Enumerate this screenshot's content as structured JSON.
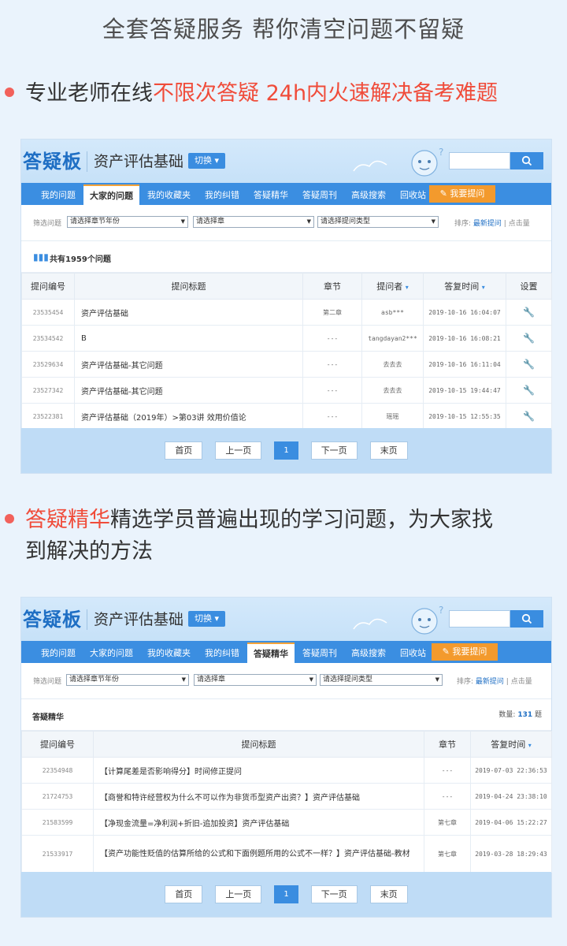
{
  "headline": "全套答疑服务 帮你清空问题不留疑",
  "bullet1": {
    "prefix": "专业老师在线",
    "highlight": "不限次答疑 24h内火速解决备考难题"
  },
  "bullet2": {
    "highlight": "答疑精华",
    "line1": "精选学员普遍出现的学习问题，为大家找",
    "line2": "到解决的方法"
  },
  "panel1": {
    "logo": "答疑板",
    "subject": "资产评估基础",
    "switch_label": "切换",
    "search_placeholder": "",
    "nav": [
      "我的问题",
      "大家的问题",
      "我的收藏夹",
      "我的纠错",
      "答疑精华",
      "答疑周刊",
      "高级搜索",
      "回收站"
    ],
    "active_tab": "大家的问题",
    "ask_label": "我要提问",
    "filter": {
      "label": "筛选问题",
      "sel1": "请选择章节年份",
      "sel2": "请选择章",
      "sel3": "请选择提问类型",
      "sort_label": "排序:",
      "sort_active": "最新提问",
      "sort_other": "点击量"
    },
    "count_text": "共有1959个问题",
    "columns": [
      "提问编号",
      "提问标题",
      "章节",
      "提问者",
      "答复时间",
      "设置"
    ],
    "rows": [
      [
        "23535454",
        "资产评估基础",
        "第二章",
        "asb***",
        "2019-10-16 16:04:07"
      ],
      [
        "23534542",
        "B",
        "---",
        "tangdayan2***",
        "2019-10-16 16:08:21"
      ],
      [
        "23529634",
        "资产评估基础-其它问题",
        "---",
        "去去去",
        "2019-10-16 16:11:04"
      ],
      [
        "23527342",
        "资产评估基础-其它问题",
        "---",
        "去去去",
        "2019-10-15 19:44:47"
      ],
      [
        "23522381",
        "资产评估基础（2019年）>第03讲  效用价值论",
        "---",
        "瑶瑶",
        "2019-10-15 12:55:35"
      ]
    ],
    "pager": {
      "first": "首页",
      "prev": "上一页",
      "current": "1",
      "next": "下一页",
      "last": "末页"
    }
  },
  "panel2": {
    "logo": "答疑板",
    "subject": "资产评估基础",
    "switch_label": "切换",
    "nav": [
      "我的问题",
      "大家的问题",
      "我的收藏夹",
      "我的纠错",
      "答疑精华",
      "答疑周刊",
      "高级搜索",
      "回收站"
    ],
    "active_tab": "答疑精华",
    "ask_label": "我要提问",
    "filter": {
      "label": "筛选问题",
      "sel1": "请选择章节年份",
      "sel2": "请选择章",
      "sel3": "请选择提问类型",
      "sort_label": "排序:",
      "sort_active": "最新提问",
      "sort_other": "点击量"
    },
    "section_title": "答疑精华",
    "qty_label": "数量:",
    "qty_value": "131",
    "qty_unit": "题",
    "columns": [
      "提问编号",
      "提问标题",
      "章节",
      "答复时间"
    ],
    "rows": [
      [
        "22354948",
        "【计算尾差是否影响得分】时间修正提问",
        "---",
        "2019-07-03 22:36:53"
      ],
      [
        "21724753",
        "【商誉和特许经营权为什么不可以作为非货币型资产出资？】资产评估基础",
        "---",
        "2019-04-24 23:38:10"
      ],
      [
        "21583599",
        "【净现金流量=净利润+折旧-追加投资】资产评估基础",
        "第七章",
        "2019-04-06 15:22:27"
      ],
      [
        "21533917",
        "【资产功能性贬值的估算所给的公式和下面例题所用的公式不一样？】资产评估基础-教材",
        "第七章",
        "2019-03-28 18:29:43"
      ]
    ],
    "pager": {
      "first": "首页",
      "prev": "上一页",
      "current": "1",
      "next": "下一页",
      "last": "末页"
    }
  }
}
